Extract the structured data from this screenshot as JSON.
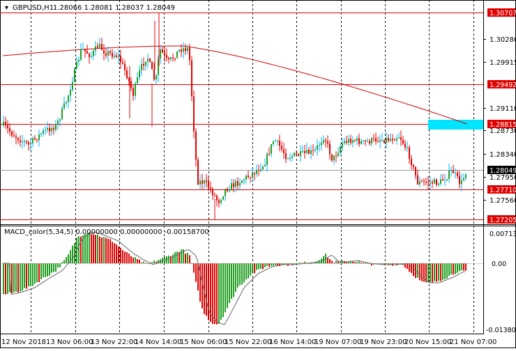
{
  "header": {
    "symbol_label": "GBPUSD,H1",
    "ohlc": "1.28066 1.28081 1.28037 1.28049"
  },
  "macd": {
    "label": "MACD_color(5,34,5) 0.00000000 0.00000000 -0.00158700",
    "ticks": [
      "0.00713",
      "0.00",
      "-0.01380"
    ]
  },
  "price_axis": {
    "ticks": [
      "1.30280",
      "1.29915",
      "1.29110",
      "1.28730",
      "1.28340",
      "1.27950",
      "1.27560"
    ]
  },
  "levels": [
    {
      "value": "1.30707",
      "color": "#e00000"
    },
    {
      "value": "1.29492",
      "color": "#e00000"
    },
    {
      "value": "1.28815",
      "color": "#e00000"
    },
    {
      "value": "1.27710",
      "color": "#e00000"
    },
    {
      "value": "1.27205",
      "color": "#e00000"
    }
  ],
  "current_price": "1.28049",
  "time_axis": [
    "12 Nov 2018",
    "13 Nov 06:00",
    "13 Nov 22:00",
    "14 Nov 14:00",
    "15 Nov 06:00",
    "15 Nov 22:00",
    "16 Nov 14:00",
    "19 Nov 07:00",
    "19 Nov 23:00",
    "20 Nov 15:00",
    "21 Nov 07:00"
  ],
  "colors": {
    "bull": "#1f9e1f",
    "bear": "#e00000",
    "bull_wick": "#00b4ff",
    "ma": "#d00000",
    "zone": "#00e5ff",
    "level": "#e00000"
  },
  "chart_data": {
    "type": "candlestick",
    "ma_label": "",
    "price_range": [
      1.2705,
      1.3105
    ],
    "macd_range": [
      -0.0138,
      0.00713
    ]
  }
}
